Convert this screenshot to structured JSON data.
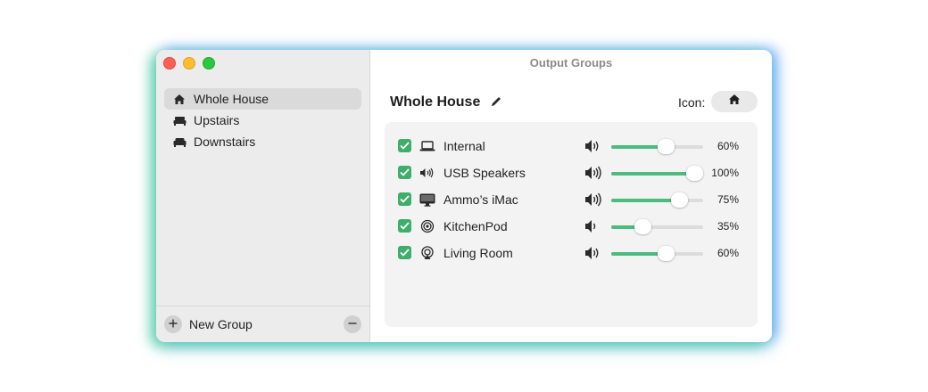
{
  "window": {
    "title": "Output Groups"
  },
  "sidebar": {
    "items": [
      {
        "label": "Whole House",
        "icon": "house-icon",
        "selected": true
      },
      {
        "label": "Upstairs",
        "icon": "bed-icon",
        "selected": false
      },
      {
        "label": "Downstairs",
        "icon": "sofa-icon",
        "selected": false
      }
    ],
    "footer": {
      "add_label": "New Group"
    }
  },
  "group": {
    "name": "Whole House",
    "icon_label": "Icon:",
    "icon": "house-icon"
  },
  "devices": [
    {
      "name": "Internal",
      "icon": "laptop-icon",
      "checked": true,
      "volume": 60,
      "volume_label": "60%"
    },
    {
      "name": "USB Speakers",
      "icon": "speaker-icon",
      "checked": true,
      "volume": 100,
      "volume_label": "100%"
    },
    {
      "name": "Ammo’s iMac",
      "icon": "imac-icon",
      "checked": true,
      "volume": 75,
      "volume_label": "75%"
    },
    {
      "name": "KitchenPod",
      "icon": "homepod-icon",
      "checked": true,
      "volume": 35,
      "volume_label": "35%"
    },
    {
      "name": "Living Room",
      "icon": "airplay-icon",
      "checked": true,
      "volume": 60,
      "volume_label": "60%"
    }
  ],
  "colors": {
    "accent_green": "#3fae6a",
    "slider_fill": "#4cbb7e",
    "close": "#fe5f57",
    "minimize": "#febc2e",
    "maximize": "#28c840"
  }
}
